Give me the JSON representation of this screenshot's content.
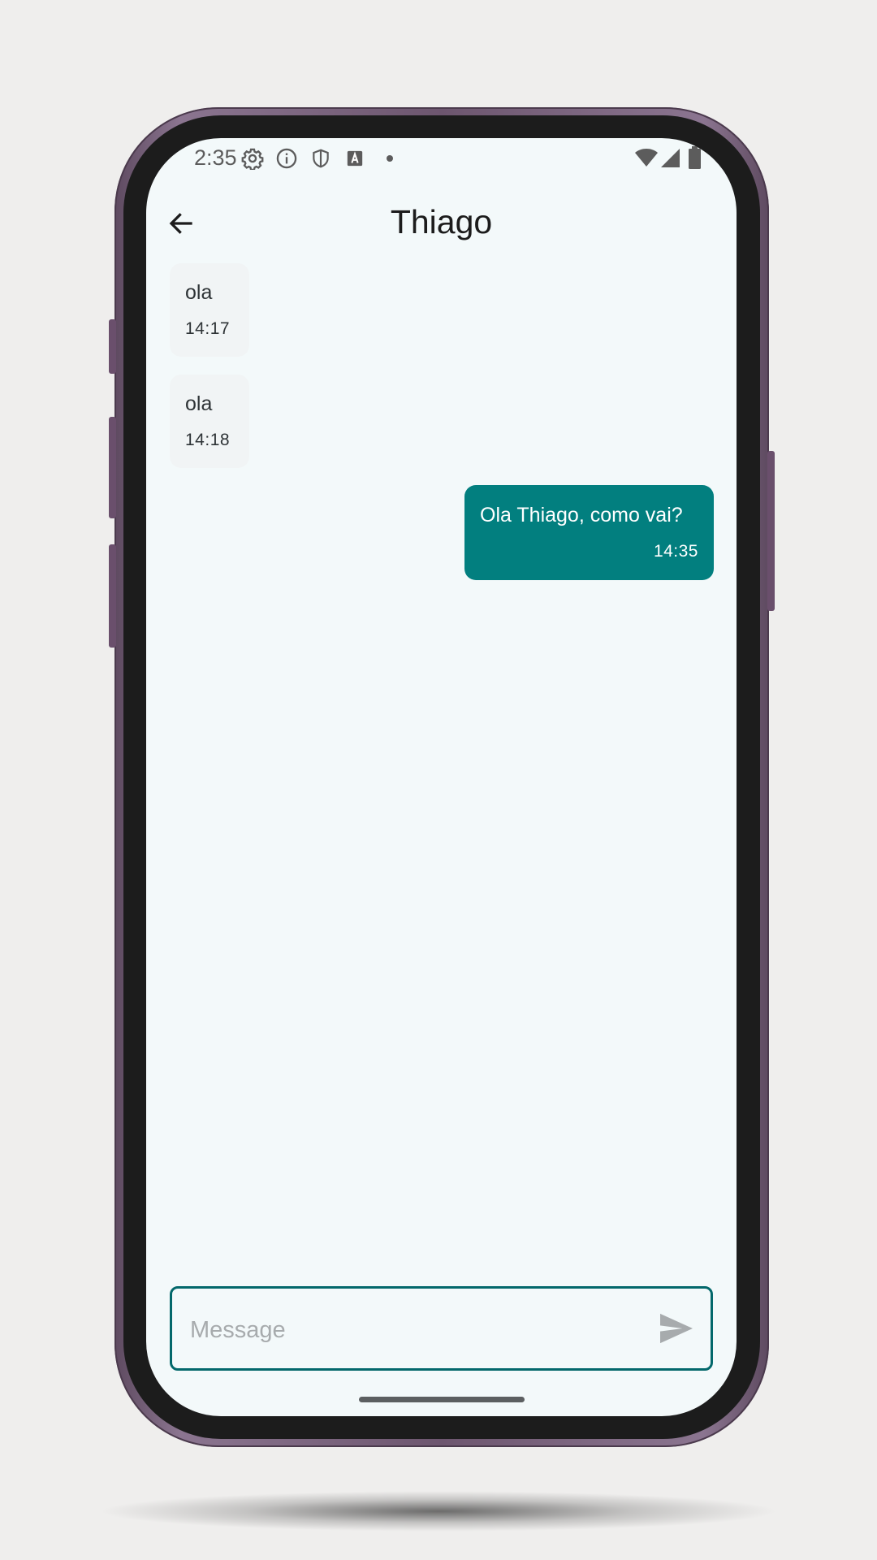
{
  "status_bar": {
    "time": "2:35",
    "left_icons": [
      "gear-icon",
      "info-icon",
      "shield-icon",
      "text-a-icon",
      "dot-icon"
    ],
    "right_icons": [
      "wifi-icon",
      "signal-icon",
      "battery-icon"
    ]
  },
  "header": {
    "title": "Thiago",
    "back_icon": "arrow-left-icon"
  },
  "messages": [
    {
      "direction": "incoming",
      "text": "ola",
      "time": "14:17"
    },
    {
      "direction": "incoming",
      "text": "ola",
      "time": "14:18"
    },
    {
      "direction": "outgoing",
      "text": "Ola Thiago, como vai?",
      "time": "14:35"
    }
  ],
  "composer": {
    "placeholder": "Message",
    "value": "",
    "send_icon": "send-icon"
  },
  "colors": {
    "screen_background": "#f3f9fa",
    "outgoing_bubble": "#027f7f",
    "incoming_bubble": "#f1f4f5",
    "input_border": "#03686b",
    "phone_frame": "#6d566f"
  }
}
